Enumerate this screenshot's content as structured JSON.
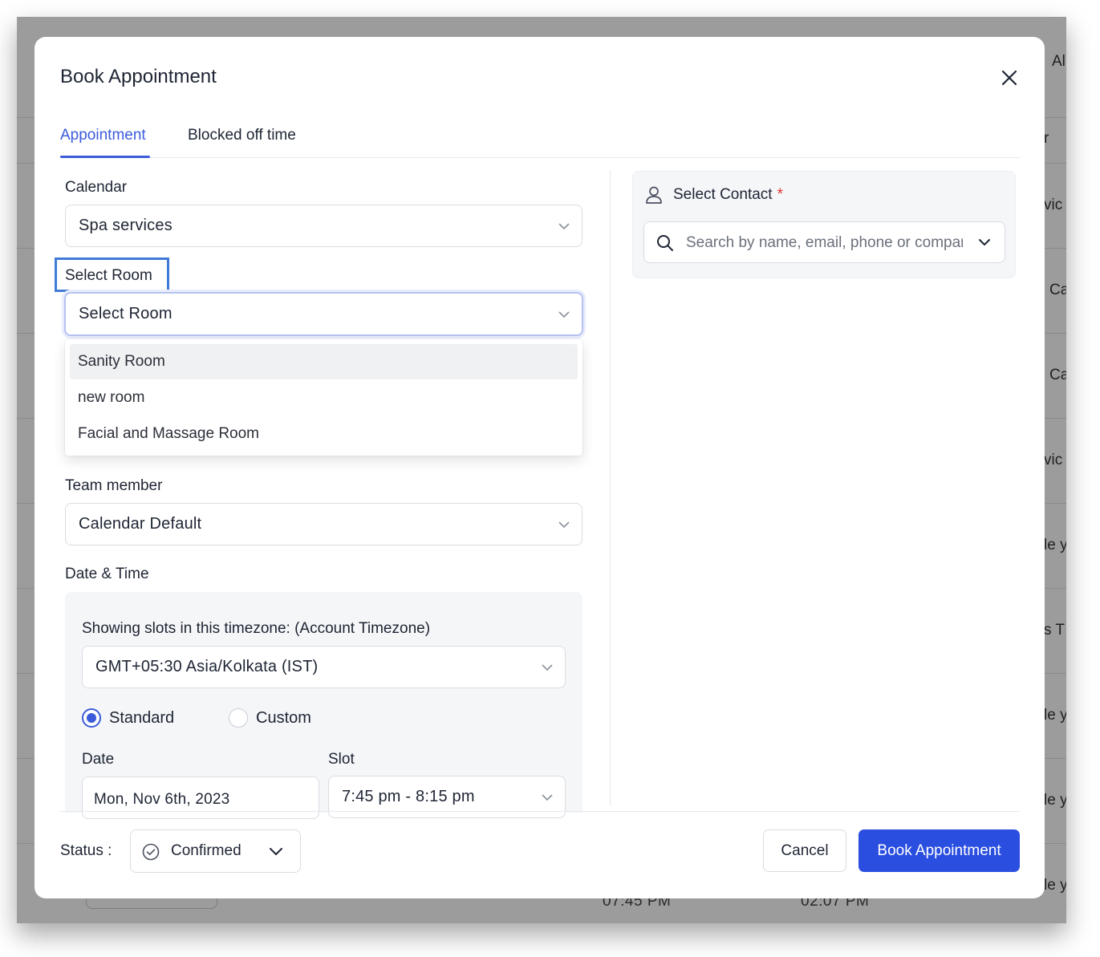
{
  "background": {
    "right_edge_fragments": [
      "Al",
      "r",
      "vic",
      "Ca",
      "Ca",
      "vic",
      "le y",
      "s T",
      "le y",
      "le y",
      "le y"
    ],
    "bottom_times": [
      "07:45 PM",
      "02:07 PM"
    ]
  },
  "modal": {
    "title": "Book Appointment",
    "close_icon": "close-icon",
    "tabs": [
      {
        "label": "Appointment",
        "active": true
      },
      {
        "label": "Blocked off time",
        "active": false
      }
    ]
  },
  "form": {
    "calendar": {
      "label": "Calendar",
      "value": "Spa services"
    },
    "room": {
      "label": "Select Room",
      "value": "Select Room",
      "options": [
        "Sanity Room",
        "new room",
        "Facial and Massage Room"
      ]
    },
    "team_member": {
      "label": "Team member",
      "value": "Calendar Default"
    },
    "date_time": {
      "label": "Date & Time",
      "timezone_label": "Showing slots in this timezone: (Account Timezone)",
      "timezone_value": "GMT+05:30 Asia/Kolkata (IST)",
      "mode_options": [
        {
          "label": "Standard",
          "checked": true
        },
        {
          "label": "Custom",
          "checked": false
        }
      ],
      "date_label": "Date",
      "date_value": "Mon, Nov 6th, 2023",
      "slot_label": "Slot",
      "slot_value": "7:45 pm - 8:15 pm"
    }
  },
  "contact": {
    "label": "Select Contact",
    "required_mark": "*",
    "search_placeholder": "Search by name, email, phone or company"
  },
  "footer": {
    "status_label": "Status :",
    "status_value": "Confirmed",
    "cancel_label": "Cancel",
    "book_label": "Book Appointment"
  },
  "colors": {
    "accent": "#3b5bdb",
    "primary_button": "#2a4ee0",
    "highlight_box": "#3f7bd6",
    "required": "#e03131"
  }
}
